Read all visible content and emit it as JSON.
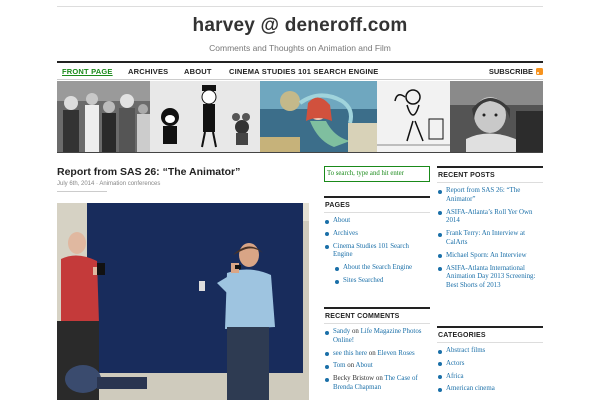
{
  "site": {
    "title": "harvey @ deneroff.com",
    "tagline": "Comments and Thoughts on Animation and Film"
  },
  "nav": {
    "items": [
      {
        "label": "FRONT PAGE"
      },
      {
        "label": "ARCHIVES"
      },
      {
        "label": "ABOUT"
      },
      {
        "label": "CINEMA STUDIES 101 SEARCH ENGINE"
      }
    ],
    "subscribe_label": "SUBSCRIBE"
  },
  "post": {
    "title": "Report from SAS 26: “The Animator”",
    "meta": "July 6th, 2014 · Animation conferences"
  },
  "search": {
    "placeholder": "To search, type and hit enter"
  },
  "pages_widget": {
    "title": "PAGES",
    "items": [
      {
        "label": "About"
      },
      {
        "label": "Archives"
      },
      {
        "label": "Cinema Studies 101 Search Engine"
      },
      {
        "label": "About the Search Engine"
      },
      {
        "label": "Sites Searched"
      }
    ]
  },
  "comments_widget": {
    "title": "RECENT COMMENTS",
    "items": [
      {
        "author": "Sandy",
        "on": "on",
        "post": "Life Magazine Photos Online!"
      },
      {
        "author": "see this here",
        "on": "on",
        "post": "Eleven Roses"
      },
      {
        "author": "Tom",
        "on": "on",
        "post": "About"
      },
      {
        "author": "Becky Bristow",
        "on": "on",
        "post": "The Case of Brenda Chapman"
      }
    ]
  },
  "recent_posts_widget": {
    "title": "RECENT POSTS",
    "items": [
      {
        "label": "Report from SAS 26: “The Animator”"
      },
      {
        "label": "ASIFA-Atlanta’s Roll Yer Own 2014"
      },
      {
        "label": "Frank Terry: An Interview at CalArts"
      },
      {
        "label": "Michael Sporn: An Interview"
      },
      {
        "label": "ASIFA-Atlanta International Animation Day 2013 Screening: Best Shorts of 2013"
      }
    ]
  },
  "categories_widget": {
    "title": "CATEGORIES",
    "items": [
      {
        "label": "Abstract films"
      },
      {
        "label": "Actors"
      },
      {
        "label": "Africa"
      },
      {
        "label": "American cinema"
      }
    ]
  },
  "colors": {
    "accent_green": "#1a8a1a",
    "link_blue": "#1a6fa8",
    "rss_orange": "#f7931e"
  }
}
